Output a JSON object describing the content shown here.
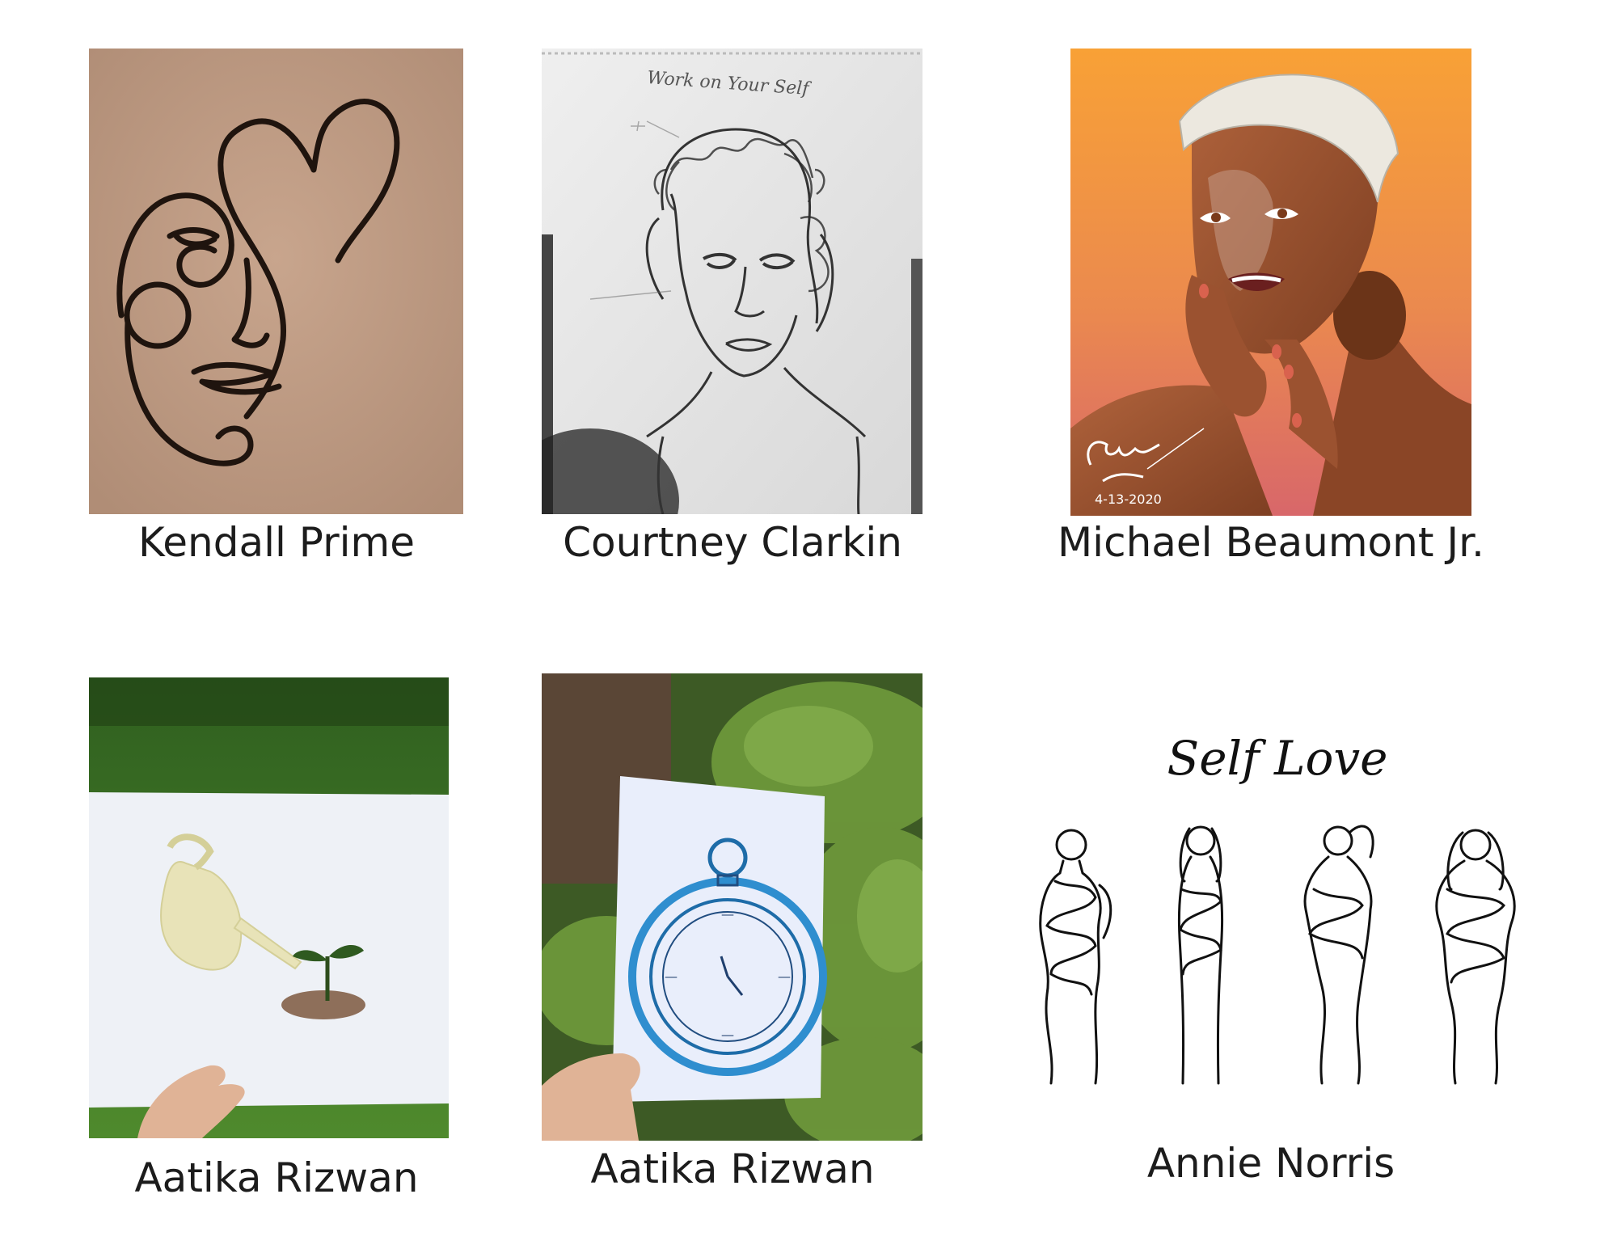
{
  "gallery": {
    "items": [
      {
        "artist": "Kendall Prime",
        "artwork": "single-line face and heart drawing"
      },
      {
        "artist": "Courtney Clarkin",
        "artwork": "pencil portrait sketch",
        "inscription": "Work on Your Self"
      },
      {
        "artist": "Michael Beaumont Jr.",
        "artwork": "digital portrait",
        "signature_date": "4-13-2020"
      },
      {
        "artist": "Aatika Rizwan",
        "artwork": "watering can and sprout"
      },
      {
        "artist": "Aatika Rizwan",
        "artwork": "blue pocket watch"
      },
      {
        "artist": "Annie Norris",
        "artwork": "self love line figures",
        "inscription": "Self Love"
      }
    ]
  }
}
